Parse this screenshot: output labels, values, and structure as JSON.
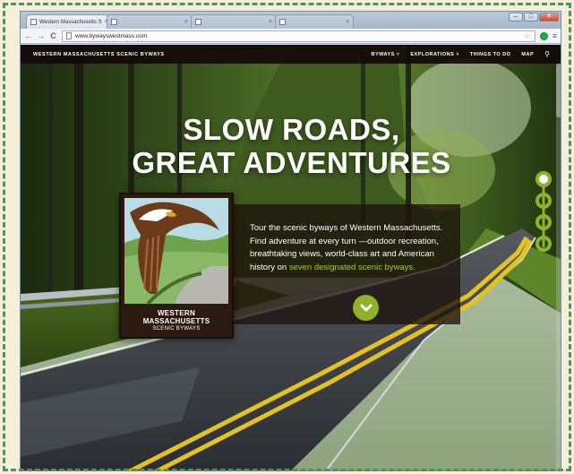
{
  "browser": {
    "tabs": [
      {
        "title": "Western Massachusetts S",
        "active": true
      },
      {
        "title": "",
        "active": false
      },
      {
        "title": "",
        "active": false
      },
      {
        "title": "",
        "active": false
      }
    ],
    "tab_close": "×",
    "window_controls": {
      "minimize": "–",
      "maximize": "□",
      "close": "✕"
    },
    "nav": {
      "back": "←",
      "forward": "→",
      "reload": "C"
    },
    "url": "www.bywayswestmass.com",
    "star": "☆",
    "menu": "≡"
  },
  "site": {
    "brand": "WESTERN MASSACHUSETTS SCENIC BYWAYS",
    "nav": [
      {
        "label": "BYWAYS",
        "dropdown": true
      },
      {
        "label": "EXPLORATIONS",
        "dropdown": true
      },
      {
        "label": "THINGS TO DO",
        "dropdown": false
      },
      {
        "label": "MAP",
        "dropdown": false
      }
    ],
    "caret": "˅",
    "search_glyph": "⚲"
  },
  "hero": {
    "headline_line1": "SLOW ROADS,",
    "headline_line2": "GREAT ADVENTURES",
    "intro_text": "Tour the scenic byways of Western Massachusetts. Find adventure at every turn —outdoor recreation, breathtaking views, world-class art and American history on ",
    "intro_link": "seven designated scenic byways."
  },
  "logo": {
    "line1": "WESTERN",
    "line2": "MASSACHUSETTS",
    "line3": "SCENIC BYWAYS"
  },
  "colors": {
    "accent": "#8fb22a",
    "link": "#a6c33a",
    "nav_bg": "#120a06",
    "frame": "#3f9a63"
  },
  "icons": {
    "search": "search-icon",
    "scroll_down": "chevron-down-icon",
    "back": "back-arrow-icon",
    "forward": "forward-arrow-icon",
    "reload": "reload-icon"
  }
}
